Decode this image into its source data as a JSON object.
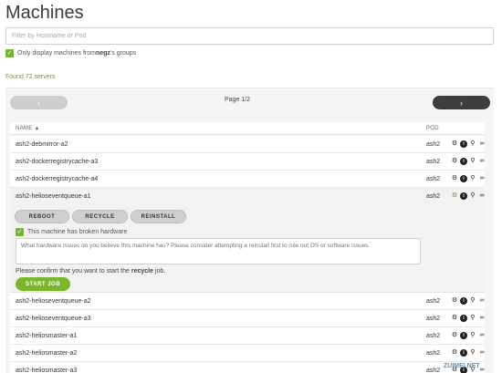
{
  "page_title": "Machines",
  "filter": {
    "placeholder": "Filter by Hostname or Pod",
    "value": ""
  },
  "only_display": {
    "prefix": "Only display machines from ",
    "group": "negz",
    "suffix": "'s groups",
    "checked": true
  },
  "found_label": "Found 72 servers",
  "pager": {
    "label": "Page 1/2",
    "prev": "‹",
    "next": "›"
  },
  "table": {
    "headers": {
      "name": "NAME",
      "pod": "POD",
      "sort_icon": "▲"
    },
    "rows": [
      {
        "name": "ash2-debmirror-a2",
        "pod": "ash2"
      },
      {
        "name": "ash2-dockerregistrycache-a3",
        "pod": "ash2"
      },
      {
        "name": "ash2-dockerregistrycache-a4",
        "pod": "ash2"
      },
      {
        "name": "ash2-helioseventqueue-a1",
        "pod": "ash2",
        "expanded": true
      },
      {
        "name": "ash2-helioseventqueue-a2",
        "pod": "ash2"
      },
      {
        "name": "ash2-helioseventqueue-a3",
        "pod": "ash2"
      },
      {
        "name": "ash2-heliosmaster-a1",
        "pod": "ash2"
      },
      {
        "name": "ash2-heliosmaster-a2",
        "pod": "ash2"
      },
      {
        "name": "ash2-heliosmaster-a3",
        "pod": "ash2"
      }
    ],
    "action_icons": [
      "gear-icon",
      "info-icon",
      "search-icon",
      "link-icon"
    ]
  },
  "expanded": {
    "buttons": {
      "reboot": "REBOOT",
      "recycle": "RECYCLE",
      "reinstall": "REINSTALL"
    },
    "broken_label": "This machine has broken hardware",
    "broken_checked": true,
    "issues_placeholder": "What hardware issues do you believe this machine has? Please consider attempting a reinstall first to rule out OS or software issues.",
    "confirm_prefix": "Please confirm that you want to start the ",
    "confirm_job": "recycle",
    "confirm_suffix": " job.",
    "start_job": "START JOB"
  },
  "watermark": "ZUIMEI.NET",
  "colors": {
    "accent": "#78b82a",
    "found": "#6b9a2d",
    "pager_next": "#3d3d3d",
    "pager_prev": "#cdcdcd"
  }
}
